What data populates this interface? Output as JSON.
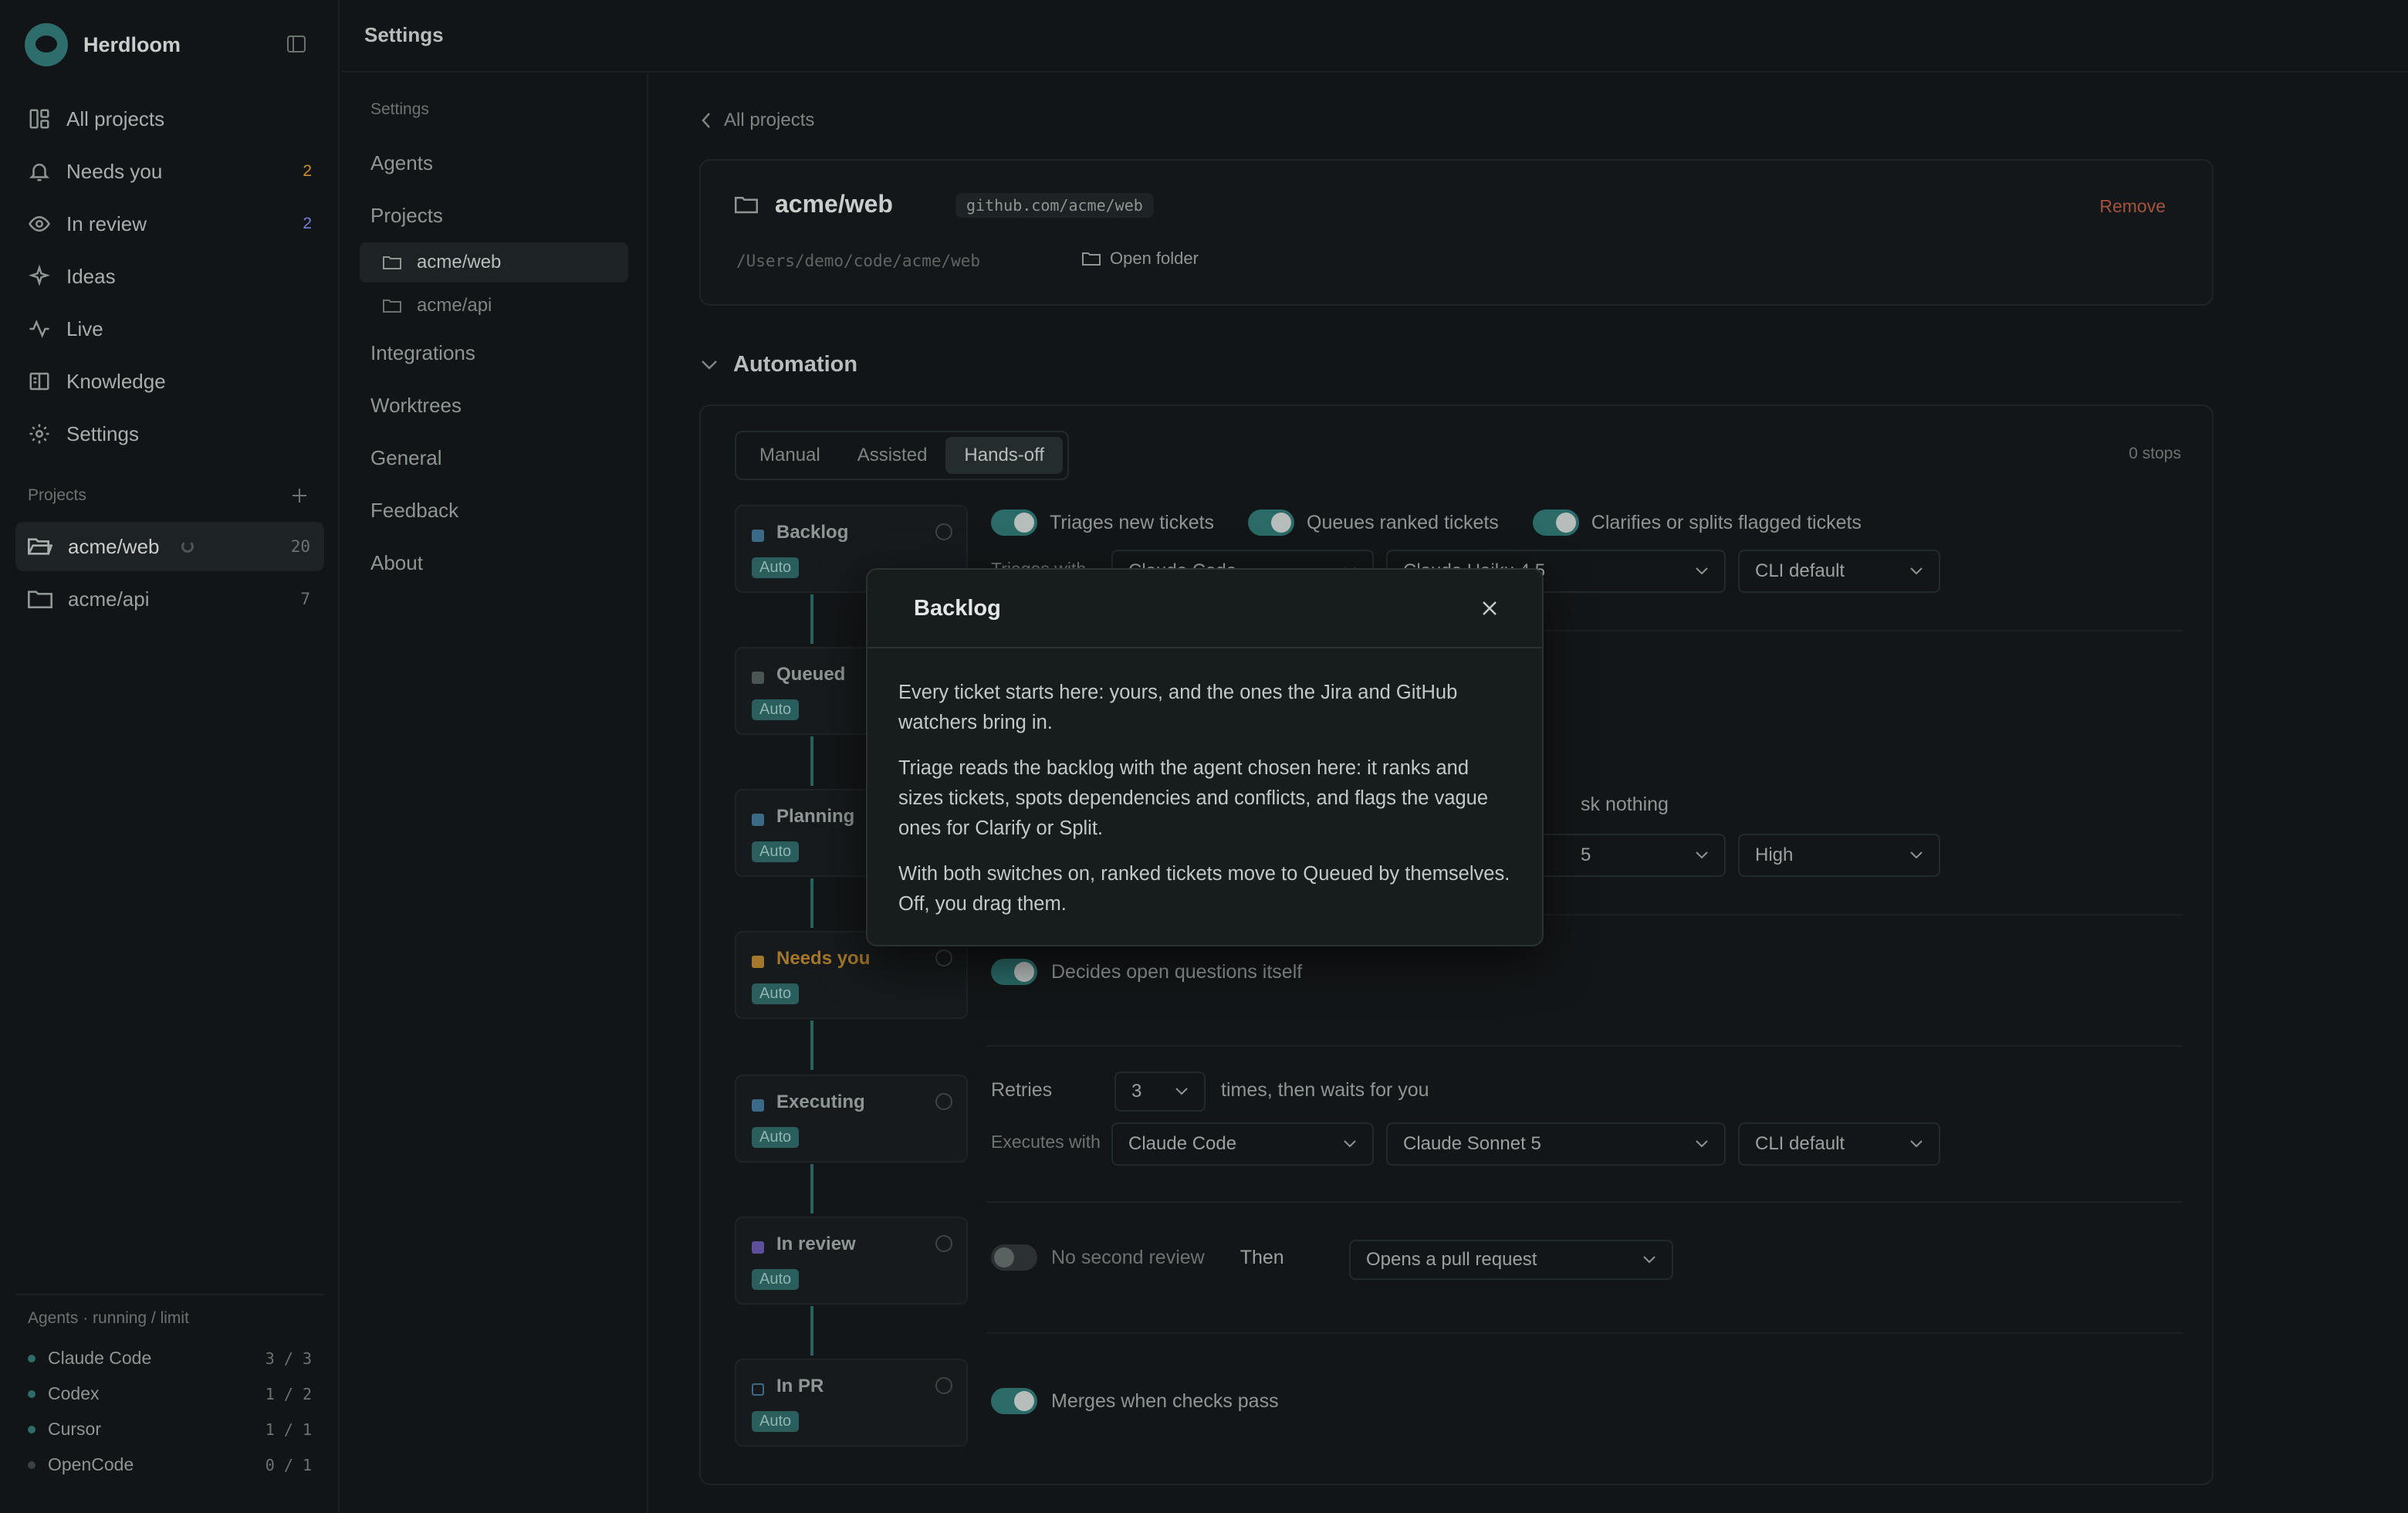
{
  "app": {
    "name": "Herdloom"
  },
  "nav": [
    {
      "label": "All projects",
      "icon": "grid-icon",
      "count": ""
    },
    {
      "label": "Needs you",
      "icon": "bell-icon",
      "count": "2",
      "color": "#c9902c"
    },
    {
      "label": "In review",
      "icon": "eye-icon",
      "count": "2",
      "color": "#6e7fd6"
    },
    {
      "label": "Ideas",
      "icon": "sparkle-icon",
      "count": ""
    },
    {
      "label": "Live",
      "icon": "pulse-icon",
      "count": ""
    },
    {
      "label": "Knowledge",
      "icon": "book-icon",
      "count": ""
    },
    {
      "label": "Settings",
      "icon": "gear-icon",
      "count": ""
    }
  ],
  "sidebar_projects": {
    "label": "Projects",
    "items": [
      {
        "name": "acme/web",
        "count": "20"
      },
      {
        "name": "acme/api",
        "count": "7"
      }
    ]
  },
  "agents": {
    "header": "Agents · running / limit",
    "items": [
      {
        "name": "Claude Code",
        "usage": "3 / 3"
      },
      {
        "name": "Codex",
        "usage": "1 / 2"
      },
      {
        "name": "Cursor",
        "usage": "1 / 1"
      },
      {
        "name": "OpenCode",
        "usage": "0 / 1"
      }
    ]
  },
  "topbar": {
    "title": "Settings"
  },
  "settings_nav": {
    "label": "Settings",
    "items": [
      "Agents",
      "Projects",
      "Integrations",
      "Worktrees",
      "General",
      "Feedback",
      "About"
    ],
    "projects": [
      "acme/web",
      "acme/api"
    ]
  },
  "crumb": "All projects",
  "project": {
    "name": "acme/web",
    "repo": "github.com/acme/web",
    "remove": "Remove",
    "path": "/Users/demo/code/acme/web",
    "open_folder": "Open folder"
  },
  "automation": {
    "title": "Automation",
    "modes": [
      "Manual",
      "Assisted",
      "Hands-off"
    ],
    "active_mode": "Hands-off",
    "stops": "0 stops",
    "stages": [
      {
        "name": "Backlog",
        "badge": "Auto"
      },
      {
        "name": "Queued",
        "badge": "Auto"
      },
      {
        "name": "Planning",
        "badge": "Auto"
      },
      {
        "name": "Needs you",
        "badge": "Auto",
        "color": "#c9902c"
      },
      {
        "name": "Executing",
        "badge": "Auto"
      },
      {
        "name": "In review",
        "badge": "Auto",
        "color": "#6e5fb8"
      },
      {
        "name": "In PR",
        "badge": "Auto"
      }
    ],
    "backlog": {
      "toggles": [
        "Triages new tickets",
        "Queues ranked tickets",
        "Clarifies or splits flagged tickets"
      ],
      "label": "Triages with",
      "agent": "Claude Code",
      "model": "Claude Haiku 4.5",
      "model_visible": "4.5",
      "effort": "CLI default"
    },
    "planning": {
      "ask_tail": "sk nothing",
      "model_visible": "5",
      "effort": "High"
    },
    "needs_you": {
      "toggle": "Decides open questions itself"
    },
    "executing": {
      "retries_label": "Retries",
      "retries": "3",
      "retries_tail": "times, then waits for you",
      "label": "Executes with",
      "agent": "Claude Code",
      "model": "Claude Sonnet 5",
      "effort": "CLI default"
    },
    "review": {
      "toggle": "No second review",
      "then": "Then",
      "action": "Opens a pull request"
    },
    "pr": {
      "toggle": "Merges when checks pass"
    }
  },
  "modal": {
    "title": "Backlog",
    "paragraphs": [
      "Every ticket starts here: yours, and the ones the Jira and GitHub watchers bring in.",
      "Triage reads the backlog with the agent chosen here: it ranks and sizes tickets, spots dependencies and conflicts, and flags the vague ones for Clarify or Split.",
      "With both switches on, ranked tickets move to Queued by themselves. Off, you drag them."
    ]
  }
}
